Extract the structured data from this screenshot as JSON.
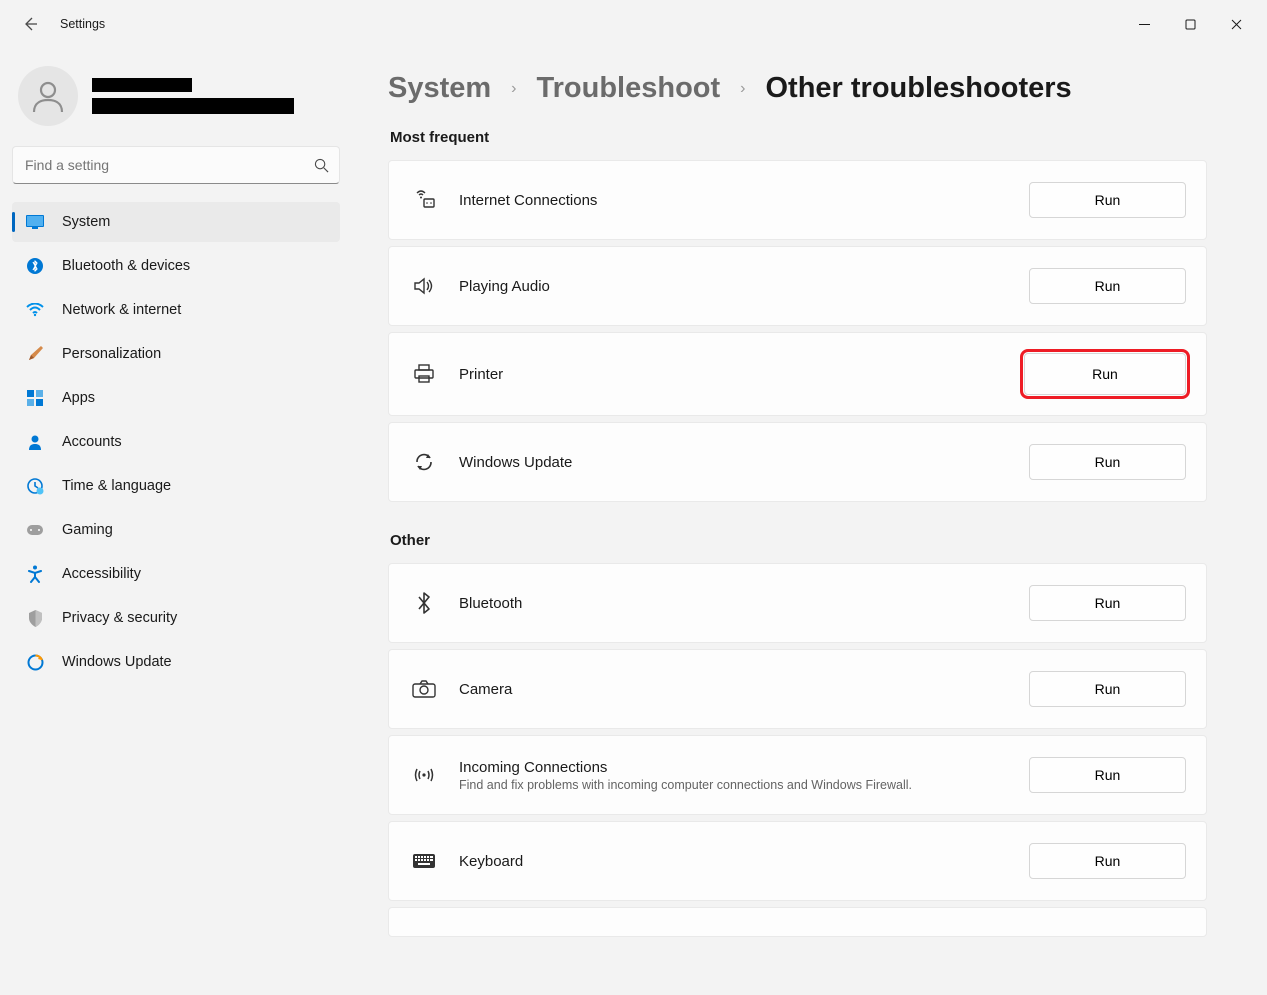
{
  "app_title": "Settings",
  "search_placeholder": "Find a setting",
  "breadcrumb": {
    "b1": "System",
    "b2": "Troubleshoot",
    "b3": "Other troubleshooters"
  },
  "sidebar": {
    "items": [
      {
        "label": "System"
      },
      {
        "label": "Bluetooth & devices"
      },
      {
        "label": "Network & internet"
      },
      {
        "label": "Personalization"
      },
      {
        "label": "Apps"
      },
      {
        "label": "Accounts"
      },
      {
        "label": "Time & language"
      },
      {
        "label": "Gaming"
      },
      {
        "label": "Accessibility"
      },
      {
        "label": "Privacy & security"
      },
      {
        "label": "Windows Update"
      }
    ]
  },
  "sections": {
    "most_frequent_title": "Most frequent",
    "other_title": "Other"
  },
  "run_label": "Run",
  "troubleshooters": {
    "most_frequent": [
      {
        "label": "Internet Connections"
      },
      {
        "label": "Playing Audio"
      },
      {
        "label": "Printer",
        "highlight": true
      },
      {
        "label": "Windows Update"
      }
    ],
    "other": [
      {
        "label": "Bluetooth"
      },
      {
        "label": "Camera"
      },
      {
        "label": "Incoming Connections",
        "sub": "Find and fix problems with incoming computer connections and Windows Firewall."
      },
      {
        "label": "Keyboard"
      }
    ]
  }
}
